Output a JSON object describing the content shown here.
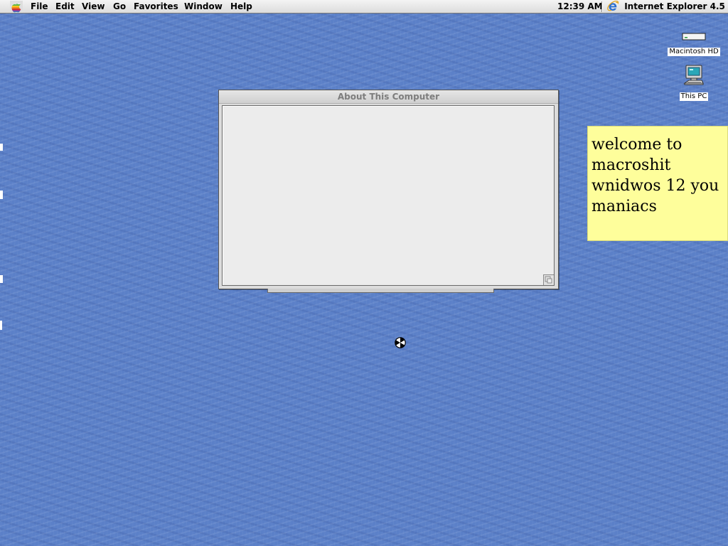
{
  "menubar": {
    "apple_icon": "rainbow-apple-icon",
    "items": [
      "File",
      "Edit",
      "View",
      "Go",
      "Favorites",
      "Window",
      "Help"
    ],
    "clock": "12:39 AM",
    "active_app": {
      "icon": "internet-explorer-icon",
      "name": "Internet Explorer 4.5"
    }
  },
  "desktop": {
    "icons": [
      {
        "label": "Macintosh HD",
        "icon": "hard-drive-icon"
      },
      {
        "label": "This PC",
        "icon": "computer-icon"
      }
    ],
    "background_color": "#5b80c8"
  },
  "window": {
    "title": "About This Computer"
  },
  "sticky_note": {
    "text": "welcome to macroshit wnidwos 12 you maniacs",
    "color": "#fefe9b"
  },
  "cursor": {
    "icon": "busy-beachball-icon"
  }
}
